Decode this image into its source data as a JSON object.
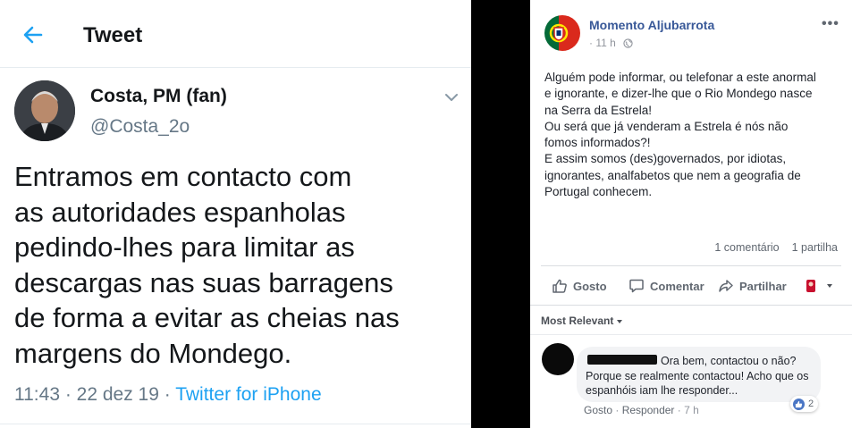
{
  "twitter": {
    "header_title": "Tweet",
    "display_name": "Costa, PM (fan)",
    "handle": "@Costa_2o",
    "tweet_lines": [
      "Entramos em contacto com",
      "as autoridades espanholas",
      "pedindo-lhes para limitar as",
      "descargas nas suas barragens",
      "de forma a evitar as cheias nas",
      "margens do Mondego."
    ],
    "time": "11:43",
    "date": "22 dez 19",
    "source": "Twitter for iPhone",
    "accent_color": "#1da1f2"
  },
  "facebook": {
    "page_name": "Momento Aljubarrota",
    "time": "11 h",
    "more_glyph": "•••",
    "post_lines": [
      "Alguém pode informar, ou telefonar a este anormal",
      "e ignorante, e dizer-lhe que o Rio Mondego nasce",
      "na Serra da Estrela!",
      "Ou será que já venderam a Estrela é nós não",
      "fomos informados?!",
      "E assim somos (des)governados, por idiotas,",
      "ignorantes, analfabetos que nem a geografia de",
      "Portugal conhecem."
    ],
    "comments_count": "1 comentário",
    "shares_count": "1 partilha",
    "actions": {
      "like": "Gosto",
      "comment": "Comentar",
      "share": "Partilhar"
    },
    "sort_label": "Most Relevant",
    "comment": {
      "text": "Ora bem, contactou o não? Porque se realmente contactou! Acho que os espanhóis iam lhe responder...",
      "like": "Gosto",
      "reply": "Responder",
      "time": "7 h",
      "reactions": "2"
    },
    "link_color": "#385898"
  }
}
